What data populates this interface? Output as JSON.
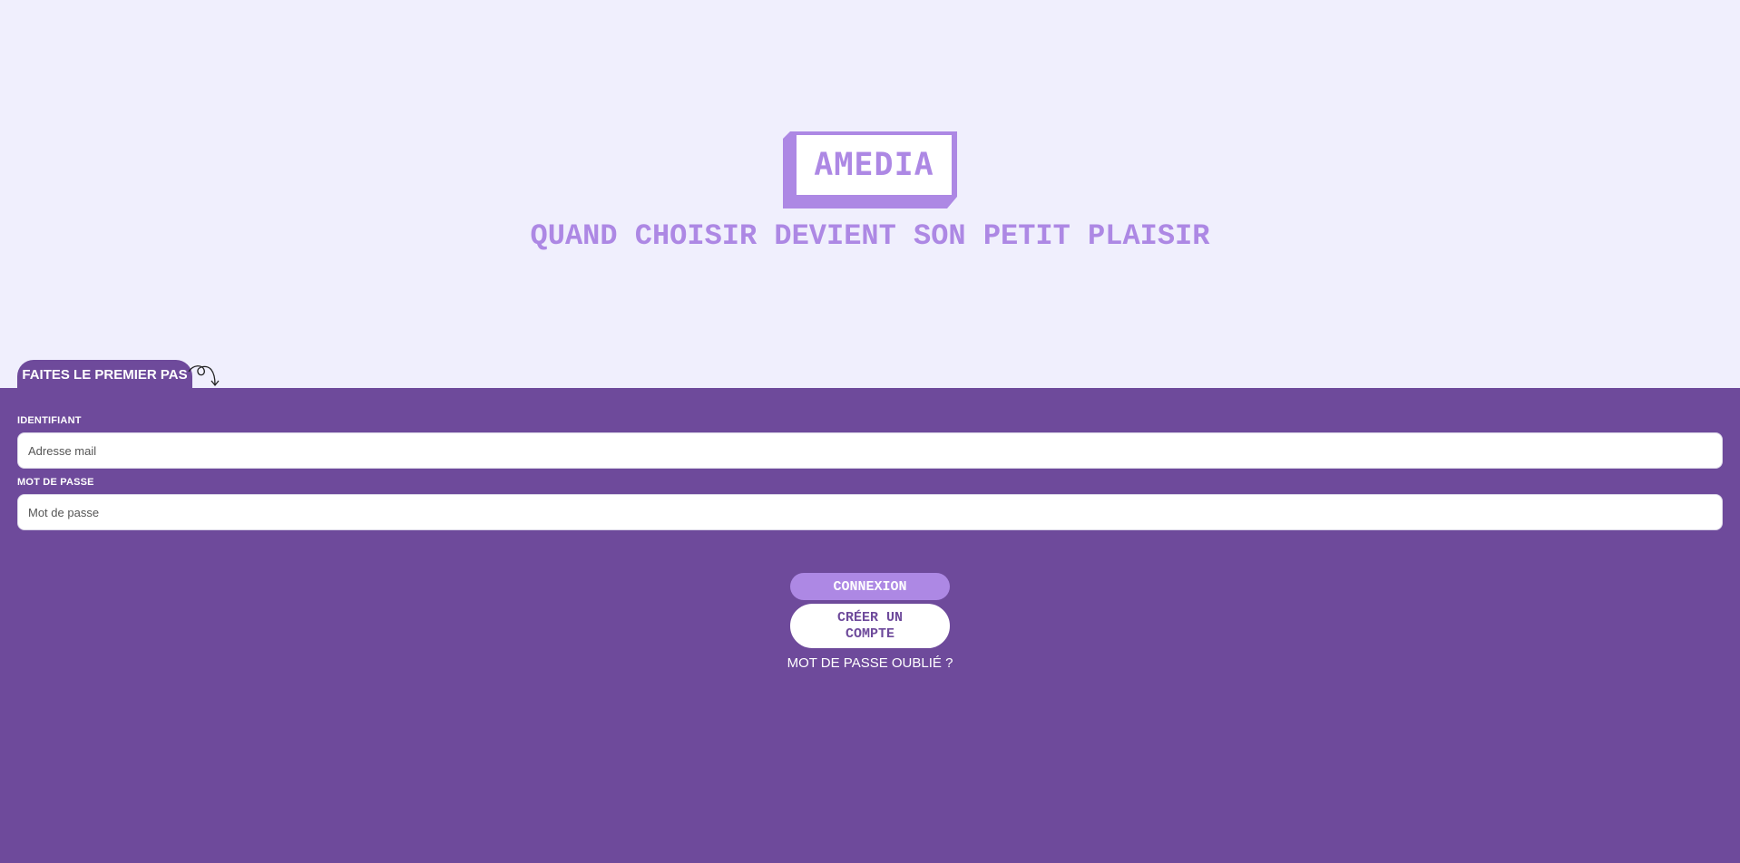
{
  "brand": {
    "logo_text": "AMEDIA",
    "tagline": "QUAND CHOISIR DEVIENT SON PETIT PLAISIR",
    "colors": {
      "accent": "#ad88e4",
      "panel": "#6e4a9b",
      "background": "#f0effd"
    }
  },
  "login": {
    "tab_label": "FAITES LE PREMIER PAS",
    "username_label": "IDENTIFIANT",
    "username_placeholder": "Adresse mail",
    "password_label": "MOT DE PASSE",
    "password_placeholder": "Mot de passe",
    "login_button": "CONNEXION",
    "create_account_button": "CRÉER UN COMPTE",
    "forgot_password": "MOT DE PASSE OUBLIÉ ?"
  },
  "icons": {
    "curl_arrow": "curly-arrow-down-icon"
  }
}
